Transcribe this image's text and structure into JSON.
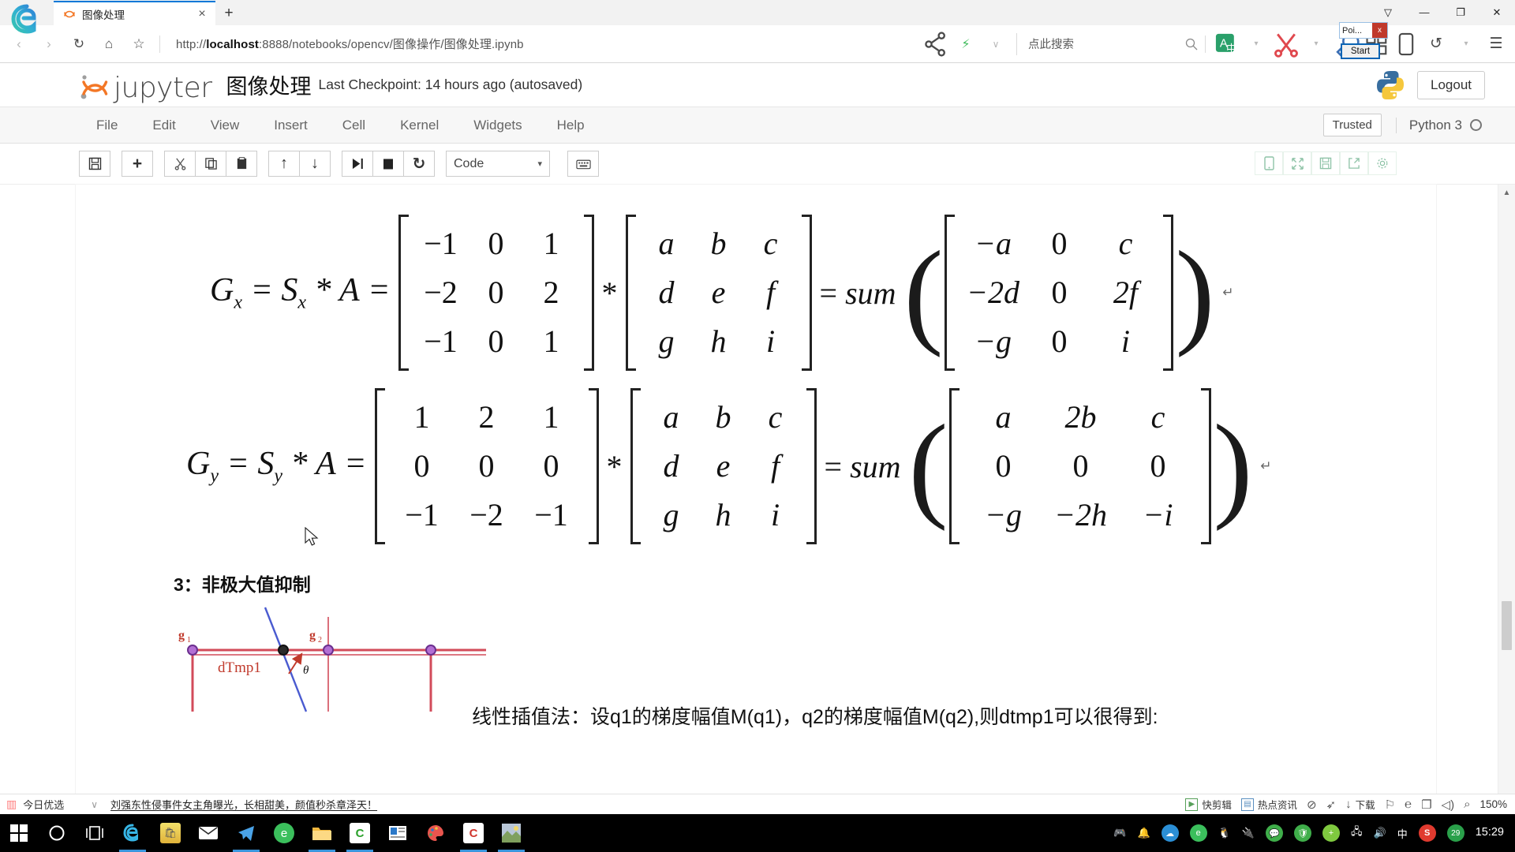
{
  "browser": {
    "tab": {
      "title": "图像处理",
      "favicon": "jupyter-icon",
      "close_label": "×",
      "new_tab_label": "+"
    },
    "window_controls": {
      "minimize": "—",
      "restore": "❐",
      "close": "✕",
      "notes": "▽"
    },
    "nav": {
      "back": "‹",
      "forward": "›",
      "refresh": "↻",
      "home": "⌂",
      "favorite": "☆",
      "url_prefix": "http://",
      "url_host": "localhost",
      "url_rest": ":8888/notebooks/opencv/图像操作/图像处理.ipynb",
      "share": "share-icon",
      "flash": "⚡",
      "chevron": "∨",
      "search_placeholder": "点此搜索",
      "search_icon": "⚲"
    },
    "popup": {
      "title": "Poi...",
      "close": "x",
      "start_label": "Start"
    }
  },
  "jupyter": {
    "logo_text": "jupyter",
    "notebook_name": "图像处理",
    "checkpoint": "Last Checkpoint: 14 hours ago (autosaved)",
    "logout_label": "Logout",
    "menus": [
      "File",
      "Edit",
      "View",
      "Insert",
      "Cell",
      "Kernel",
      "Widgets",
      "Help"
    ],
    "trusted_label": "Trusted",
    "kernel_label": "Python 3",
    "toolbar": {
      "save": "🖫",
      "insert": "+",
      "cut": "✂",
      "copy": "⧉",
      "paste": "⎘",
      "move_up": "↑",
      "move_down": "↓",
      "run": "▶❘",
      "stop": "■",
      "restart": "↻",
      "cell_type": "Code",
      "cell_type_caret": "▾",
      "keyboard": "⌨"
    },
    "right_icons": [
      "tablet-view-icon",
      "fullscreen-icon",
      "save-alt-icon",
      "share-out-icon",
      "settings-gear-icon"
    ]
  },
  "notebook": {
    "equations": [
      {
        "id": "gx",
        "lhs": [
          "G",
          "x",
          "=",
          "S",
          "x",
          "*",
          "A",
          "="
        ],
        "kernel": [
          [
            "−1",
            "0",
            "1"
          ],
          [
            "−2",
            "0",
            "2"
          ],
          [
            "−1",
            "0",
            "1"
          ]
        ],
        "operator": "*",
        "image": [
          [
            "a",
            "b",
            "c"
          ],
          [
            "d",
            "e",
            "f"
          ],
          [
            "g",
            "h",
            "i"
          ]
        ],
        "equals": "=",
        "sum_label": "sum",
        "result": [
          [
            "−a",
            "0",
            "c"
          ],
          [
            "−2d",
            "0",
            "2f"
          ],
          [
            "−g",
            "0",
            "i"
          ]
        ],
        "pilcrow": "↵"
      },
      {
        "id": "gy",
        "lhs": [
          "G",
          "y",
          "=",
          "S",
          "y",
          "*",
          "A",
          "="
        ],
        "kernel": [
          [
            "1",
            "2",
            "1"
          ],
          [
            "0",
            "0",
            "0"
          ],
          [
            "−1",
            "−2",
            "−1"
          ]
        ],
        "operator": "*",
        "image": [
          [
            "a",
            "b",
            "c"
          ],
          [
            "d",
            "e",
            "f"
          ],
          [
            "g",
            "h",
            "i"
          ]
        ],
        "equals": "=",
        "sum_label": "sum",
        "result": [
          [
            "a",
            "2b",
            "c"
          ],
          [
            "0",
            "0",
            "0"
          ],
          [
            "−g",
            "−2h",
            "−i"
          ]
        ],
        "pilcrow": "↵"
      }
    ],
    "heading": "3：非极大值抑制",
    "paragraph": "线性插值法：设q1的梯度幅值M(q1)，q2的梯度幅值M(q2),则dtmp1可以很得到:",
    "diagram": {
      "label_g1": "g",
      "label_g1_sub": "1",
      "label_g2": "g",
      "label_g2_sub": "2",
      "label_dtmp": "dTmp1",
      "label_theta": "θ"
    }
  },
  "bottom_bar": {
    "gift_label": "今日优选",
    "chevron": "∨",
    "news": "刘强东性侵事件女主角曝光，长相甜美，颜值秒杀章泽天！",
    "items": [
      {
        "icon": "clip-icon",
        "label": "快剪辑"
      },
      {
        "icon": "news-icon",
        "label": "热点资讯"
      },
      {
        "icon": "shield-icon",
        "label": ""
      },
      {
        "icon": "rocket-icon",
        "label": ""
      },
      {
        "icon": "download-icon",
        "label": "下载"
      },
      {
        "icon": "flag-icon",
        "label": ""
      },
      {
        "icon": "edge-icon",
        "label": ""
      },
      {
        "icon": "window-icon",
        "label": ""
      },
      {
        "icon": "sound-icon",
        "label": ""
      },
      {
        "icon": "zoom-icon",
        "label": ""
      }
    ],
    "zoom_level": "150%"
  },
  "taskbar": {
    "start": "⊞",
    "cortana": "○",
    "taskview": "[ ]",
    "apps": [
      "edge",
      "store",
      "mail",
      "telegram",
      "360-browser",
      "explorer",
      "wechat-pc",
      "news",
      "paint",
      "clion",
      "jupyter-app"
    ],
    "tray": {
      "ime": "中",
      "sogou": "S",
      "shield_count": "29",
      "time": "15:29"
    }
  },
  "colors": {
    "accent_blue": "#0078d7",
    "jupyter_orange": "#f37726",
    "taskbar_bg": "#000000",
    "green_icon": "#8ec3a7"
  }
}
